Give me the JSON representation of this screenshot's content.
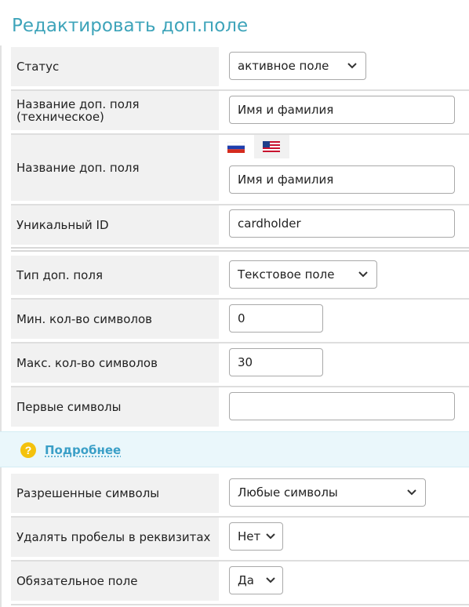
{
  "page_title": "Редактировать доп.поле",
  "fields": {
    "status": {
      "label": "Статус",
      "value": "активное поле"
    },
    "tech_name": {
      "label": "Название доп. поля\n(техническое)",
      "value": "Имя и фамилия"
    },
    "name": {
      "label": "Название доп. поля",
      "value": "Имя и фамилия",
      "languages": [
        "ru",
        "us"
      ]
    },
    "unique_id": {
      "label": "Уникальный ID",
      "value": "cardholder"
    },
    "type": {
      "label": "Тип доп. поля",
      "value": "Текстовое поле"
    },
    "min_chars": {
      "label": "Мин. кол-во символов",
      "value": "0"
    },
    "max_chars": {
      "label": "Макс. кол-во символов",
      "value": "30"
    },
    "first_chars": {
      "label": "Первые символы",
      "value": ""
    },
    "allowed_chars": {
      "label": "Разрешенные символы",
      "value": "Любые символы"
    },
    "remove_spaces": {
      "label": "Удалять пробелы в реквизитах",
      "value": "Нет"
    },
    "required": {
      "label": "Обязательное поле",
      "value": "Да"
    }
  },
  "info_panel": {
    "icon": "question-icon",
    "link_text": "Подробнее"
  },
  "colors": {
    "title": "#3ea4ba",
    "label_bg": "#f1f1f1",
    "info_bg": "#eaf7fb",
    "link": "#3a9fc7",
    "icon": "#f4c20d"
  }
}
